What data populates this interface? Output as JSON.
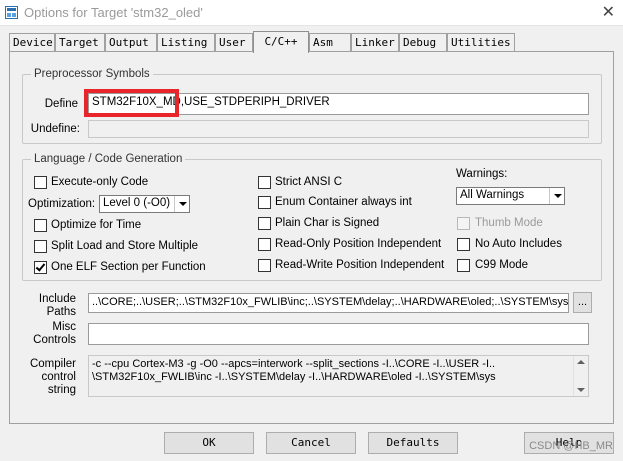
{
  "window": {
    "title": "Options for Target 'stm32_oled'",
    "close_glyph": "✕"
  },
  "tabs": [
    {
      "label": "Device"
    },
    {
      "label": "Target"
    },
    {
      "label": "Output"
    },
    {
      "label": "Listing"
    },
    {
      "label": "User"
    },
    {
      "label": "C/C++"
    },
    {
      "label": "Asm"
    },
    {
      "label": "Linker"
    },
    {
      "label": "Debug"
    },
    {
      "label": "Utilities"
    }
  ],
  "active_tab": "C/C++",
  "preprocessor": {
    "group_label": "Preprocessor Symbols",
    "define_label": "Define",
    "define_value": "STM32F10X_MD,USE_STDPERIPH_DRIVER",
    "undefine_label": "Undefine:",
    "undefine_value": "",
    "highlight_color": "#e8252a"
  },
  "language": {
    "group_label": "Language / Code Generation",
    "execute_only": {
      "label": "Execute-only Code",
      "checked": false
    },
    "optimization_label": "Optimization:",
    "optimization_value": "Level 0 (-O0)",
    "optimize_time": {
      "label": "Optimize for Time",
      "checked": false
    },
    "split_load": {
      "label": "Split Load and Store Multiple",
      "checked": false
    },
    "one_elf": {
      "label": "One ELF Section per Function",
      "checked": true
    },
    "strict_ansi": {
      "label": "Strict ANSI C",
      "checked": false
    },
    "enum_container": {
      "label": "Enum Container always int",
      "checked": false
    },
    "plain_char": {
      "label": "Plain Char is Signed",
      "checked": false
    },
    "ro_pi": {
      "label": "Read-Only Position Independent",
      "checked": false
    },
    "rw_pi": {
      "label": "Read-Write Position Independent",
      "checked": false
    },
    "warnings_label": "Warnings:",
    "warnings_value": "All Warnings",
    "thumb_mode": {
      "label": "Thumb Mode",
      "checked": false,
      "disabled": true
    },
    "no_auto_includes": {
      "label": "No Auto Includes",
      "checked": false
    },
    "c99_mode": {
      "label": "C99 Mode",
      "checked": false
    }
  },
  "include_paths": {
    "label_line1": "Include",
    "label_line2": "Paths",
    "value": "..\\CORE;..\\USER;..\\STM32F10x_FWLIB\\inc;..\\SYSTEM\\delay;..\\HARDWARE\\oled;..\\SYSTEM\\sys",
    "browse_label": "..."
  },
  "misc_controls": {
    "label_line1": "Misc",
    "label_line2": "Controls",
    "value": ""
  },
  "compiler_control": {
    "label_line1": "Compiler",
    "label_line2": "control",
    "label_line3": "string",
    "line1": "-c --cpu Cortex-M3 -g -O0 --apcs=interwork --split_sections -I..\\CORE -I..\\USER -I..",
    "line2": "\\STM32F10x_FWLIB\\inc -I..\\SYSTEM\\delay -I..\\HARDWARE\\oled -I..\\SYSTEM\\sys"
  },
  "buttons": {
    "ok": "OK",
    "cancel": "Cancel",
    "defaults": "Defaults",
    "help": "Help"
  },
  "watermark": "CSDN @HB_MR"
}
